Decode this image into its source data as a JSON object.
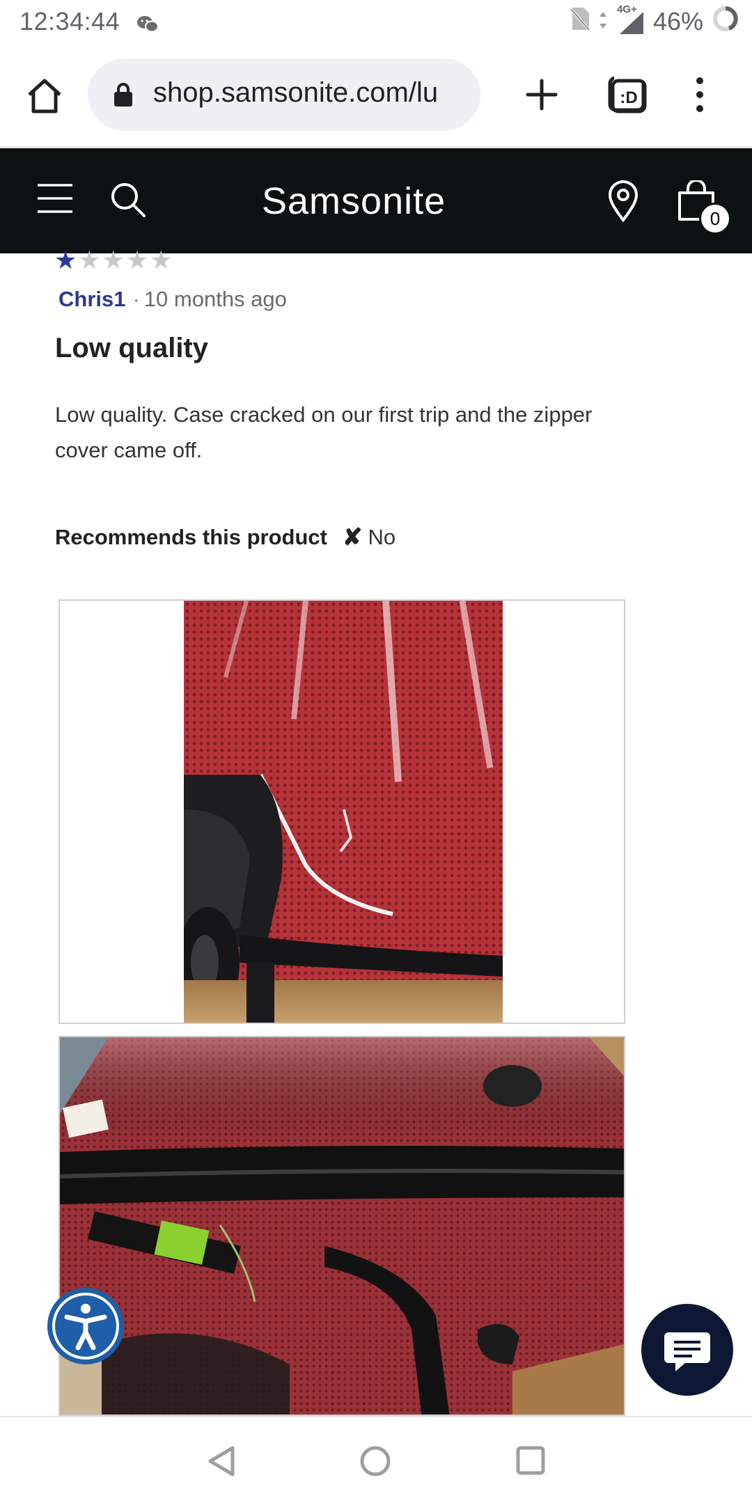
{
  "status_bar": {
    "time": "12:34:44",
    "network": "4G+",
    "battery": "46%"
  },
  "browser": {
    "url": "shop.samsonite.com/lu",
    "icons": [
      "home-icon",
      "lock-icon",
      "plus-icon",
      "tab-switcher-icon",
      "overflow-menu-icon"
    ]
  },
  "site_header": {
    "brand": "Samsonite",
    "cart_count": "0",
    "icons": [
      "hamburger-icon",
      "search-icon",
      "location-pin-icon",
      "shopping-bag-icon"
    ],
    "background": "#0b1211"
  },
  "review": {
    "rating": 1,
    "rating_max": 5,
    "author": "Chris1",
    "separator": "·",
    "time_ago": "10 months ago",
    "title": "Low quality",
    "body": "Low quality. Case cracked on our first trip and the zipper cover came off.",
    "recommend_label": "Recommends this product",
    "recommend_mark": "✘",
    "recommend_value": "No",
    "accent_color": "#2d3a8c"
  },
  "photos": [
    {
      "subject": "red hardside suitcase with cracked corner near wheel"
    },
    {
      "subject": "red hardside suitcase with detached zipper cover"
    }
  ],
  "floating": {
    "icons": [
      "accessibility-icon",
      "chat-icon"
    ]
  },
  "nav_bar": {
    "icons": [
      "back-triangle-icon",
      "home-circle-icon",
      "recents-square-icon"
    ]
  }
}
